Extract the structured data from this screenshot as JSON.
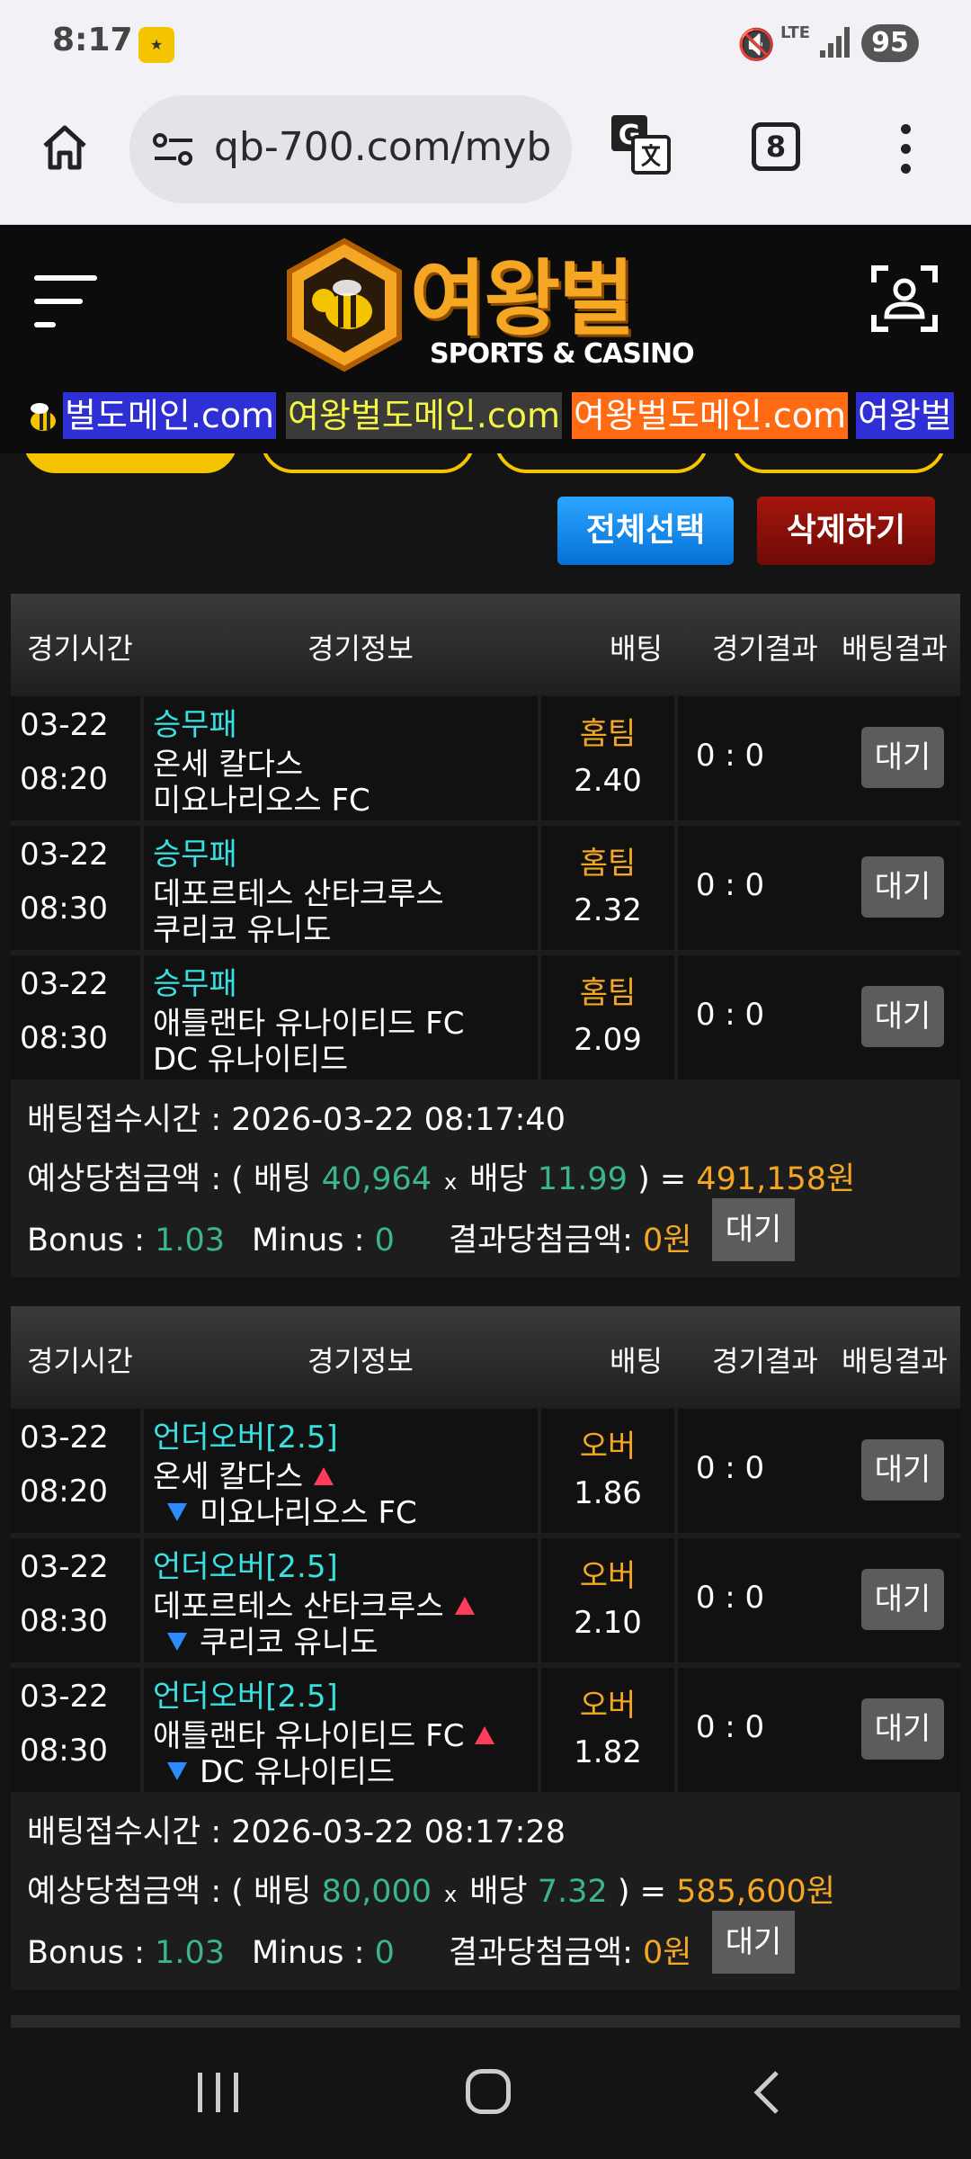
{
  "status_bar": {
    "time": "8:17",
    "battery": "95",
    "network": "LTE"
  },
  "browser": {
    "url": "qb-700.com/myb",
    "tab_count": "8"
  },
  "site": {
    "logo_title": "여왕벌",
    "logo_subtitle": "SPORTS & CASINO",
    "marquee": [
      {
        "text": "벌도메인.com",
        "bg": "#2f2fd6",
        "color": "#ffffff"
      },
      {
        "text": "여왕벌도메인.com",
        "bg": "#3a3a3a",
        "color": "#f5f545"
      },
      {
        "text": "여왕벌도메인.com",
        "bg": "#ff6a13",
        "color": "#ffffff"
      },
      {
        "text": "여왕벌",
        "bg": "#2f2fd6",
        "color": "#ffffff"
      }
    ]
  },
  "actions": {
    "select_all": "전체선택",
    "delete": "삭제하기"
  },
  "table_headers": {
    "time": "경기시간",
    "info": "경기정보",
    "bet": "배팅",
    "game_result": "경기결과",
    "bet_result": "배팅결과"
  },
  "bets": [
    {
      "rows": [
        {
          "date": "03-22",
          "hour": "08:20",
          "type": "승무패",
          "home": "온세 칼다스",
          "away": "미요나리오스 FC",
          "pick": "홈팀",
          "odds": "2.40",
          "score": "0 : 0",
          "status": "대기"
        },
        {
          "date": "03-22",
          "hour": "08:30",
          "type": "승무패",
          "home": "데포르테스 산타크루스",
          "away": "쿠리코 유니도",
          "pick": "홈팀",
          "odds": "2.32",
          "score": "0 : 0",
          "status": "대기"
        },
        {
          "date": "03-22",
          "hour": "08:30",
          "type": "승무패",
          "home": "애틀랜타 유나이티드 FC",
          "away": "DC 유나이티드",
          "pick": "홈팀",
          "odds": "2.09",
          "score": "0 : 0",
          "status": "대기"
        }
      ],
      "summary": {
        "time_label": "배팅접수시간 : ",
        "time": "2026-03-22 08:17:40",
        "expected_label": "예상당첨금액 : ( 배팅 ",
        "stake": "40,964",
        "times": "x",
        "odds_label": "배당 ",
        "total_odds": "11.99",
        "eq": " ) = ",
        "payout": "491,158원",
        "bonus_label": "Bonus : ",
        "bonus": "1.03",
        "minus_label": "Minus : ",
        "minus": "0",
        "result_label": "결과당첨금액: ",
        "result": "0원",
        "status": "대기"
      }
    },
    {
      "rows": [
        {
          "date": "03-22",
          "hour": "08:20",
          "type": "언더오버[2.5]",
          "home": "온세 칼다스",
          "away": "미요나리오스 FC",
          "pick": "오버",
          "odds": "1.86",
          "score": "0 : 0",
          "status": "대기"
        },
        {
          "date": "03-22",
          "hour": "08:30",
          "type": "언더오버[2.5]",
          "home": "데포르테스 산타크루스",
          "away": "쿠리코 유니도",
          "pick": "오버",
          "odds": "2.10",
          "score": "0 : 0",
          "status": "대기"
        },
        {
          "date": "03-22",
          "hour": "08:30",
          "type": "언더오버[2.5]",
          "home": "애틀랜타 유나이티드 FC",
          "away": "DC 유나이티드",
          "pick": "오버",
          "odds": "1.82",
          "score": "0 : 0",
          "status": "대기"
        }
      ],
      "summary": {
        "time_label": "배팅접수시간 : ",
        "time": "2026-03-22 08:17:28",
        "expected_label": "예상당첨금액 : ( 배팅 ",
        "stake": "80,000",
        "times": "x",
        "odds_label": "배당 ",
        "total_odds": "7.32",
        "eq": " ) = ",
        "payout": "585,600원",
        "bonus_label": "Bonus : ",
        "bonus": "1.03",
        "minus_label": "Minus : ",
        "minus": "0",
        "result_label": "결과당첨금액: ",
        "result": "0원",
        "status": "대기"
      }
    }
  ]
}
